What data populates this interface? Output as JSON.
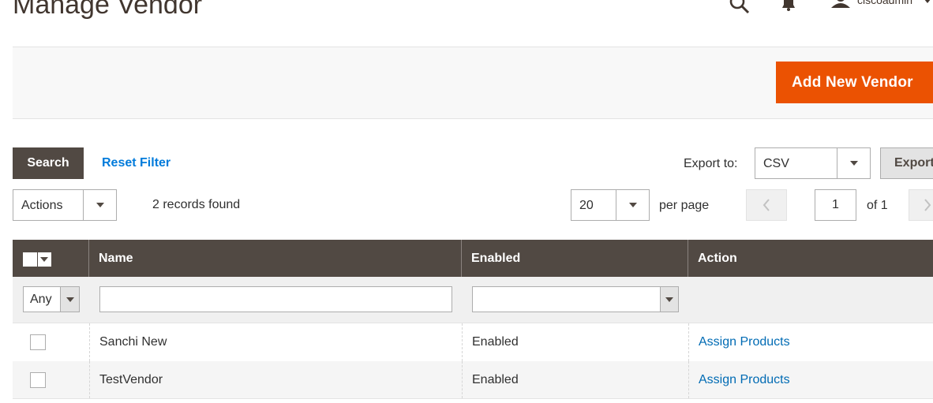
{
  "header": {
    "title": "Manage Vendor",
    "username": "ciscoadmin"
  },
  "page_actions": {
    "add_label": "Add New Vendor"
  },
  "toolbar": {
    "search_label": "Search",
    "reset_label": "Reset Filter",
    "export_label": "Export to:",
    "export_value": "CSV",
    "export_button": "Export",
    "actions_value": "Actions",
    "records_found": "2 records found",
    "per_page_value": "20",
    "per_page_label": "per page",
    "page_current": "1",
    "page_of": "of 1"
  },
  "grid": {
    "columns": [
      "Name",
      "Enabled",
      "Action"
    ],
    "filter_any": "Any",
    "rows": [
      {
        "name": "Sanchi New",
        "enabled": "Enabled",
        "action": "Assign Products"
      },
      {
        "name": "TestVendor",
        "enabled": "Enabled",
        "action": "Assign Products"
      }
    ]
  },
  "colors": {
    "accent": "#eb5202",
    "header_dark": "#514943",
    "link": "#006bb4"
  },
  "icons": [
    "search-icon",
    "bell-icon",
    "user-icon",
    "chevron-down-icon",
    "chevron-left-icon",
    "chevron-right-icon"
  ]
}
